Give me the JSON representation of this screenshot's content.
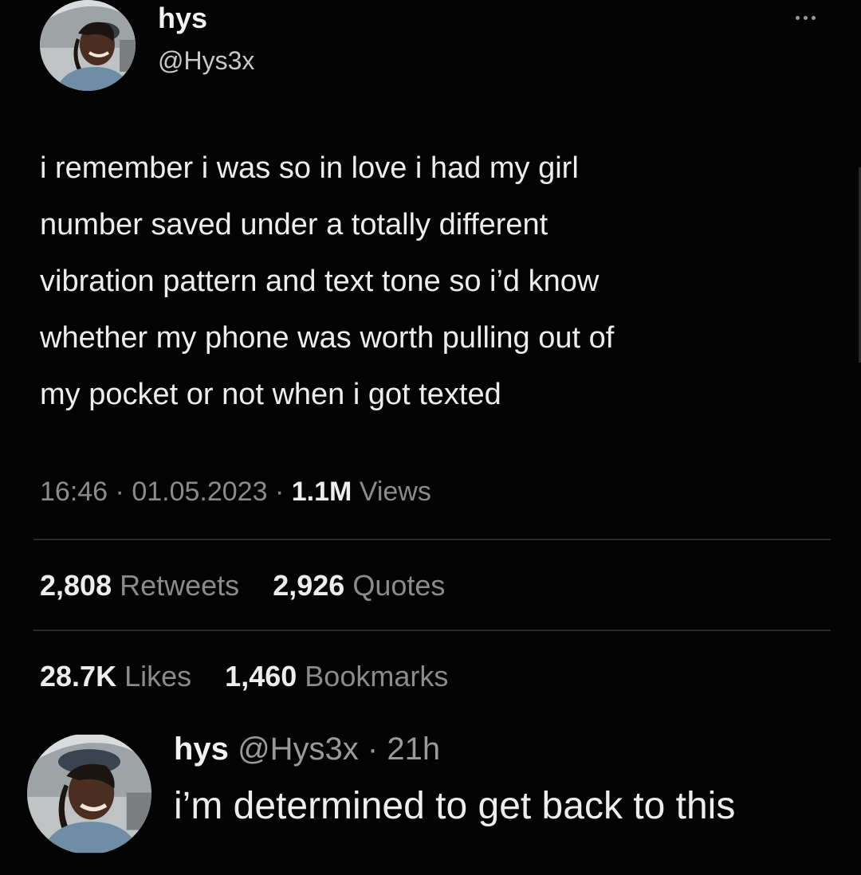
{
  "tweet": {
    "author_name": "hys",
    "author_handle": "@Hys3x",
    "more_icon": "more-horizontal-icon",
    "text_lines": [
      "i remember i was so in love i had my girl",
      "number saved under a totally different",
      "vibration pattern and text tone so i’d know",
      "whether my phone was worth pulling out of",
      "my pocket or not when i got texted"
    ],
    "time": "16:46",
    "date": "01.05.2023",
    "views_count": "1.1M",
    "views_label": "Views",
    "retweets_count": "2,808",
    "retweets_label": "Retweets",
    "quotes_count": "2,926",
    "quotes_label": "Quotes",
    "likes_count": "28.7K",
    "likes_label": "Likes",
    "bookmarks_count": "1,460",
    "bookmarks_label": "Bookmarks"
  },
  "reply": {
    "author_name": "hys",
    "author_handle": "@Hys3x",
    "age": "21h",
    "text": "i’m determined to get back to this"
  },
  "colors": {
    "background": "#030303",
    "primary_text": "#ededed",
    "secondary_text": "#8b8b8b",
    "divider": "#2b2b2b"
  }
}
